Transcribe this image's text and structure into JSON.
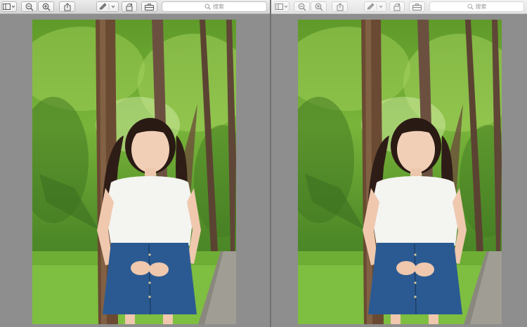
{
  "windows": [
    {
      "search": {
        "placeholder": "搜索"
      },
      "icons": {
        "sidebar": "sidebar-toggle-icon",
        "zoom_out": "zoom-out-icon",
        "zoom_in": "zoom-in-icon",
        "share": "share-icon",
        "markup": "markup-pen-icon",
        "rotate": "rotate-icon",
        "toolbox": "toolbox-icon",
        "search": "search-icon"
      },
      "document": {
        "content": "photo-girl-in-park",
        "image_alt": ""
      }
    },
    {
      "search": {
        "placeholder": "搜索"
      },
      "icons": {
        "sidebar": "sidebar-toggle-icon",
        "zoom_out": "zoom-out-icon",
        "zoom_in": "zoom-in-icon",
        "share": "share-icon",
        "markup": "markup-pen-icon",
        "rotate": "rotate-icon",
        "toolbox": "toolbox-icon",
        "search": "search-icon"
      },
      "document": {
        "content": "photo-girl-in-park",
        "image_alt": ""
      }
    }
  ],
  "colors": {
    "window_background": "#8e8e8e",
    "toolbar_active": "#d6d6d6",
    "toolbar_inactive": "#e3e3e3"
  }
}
